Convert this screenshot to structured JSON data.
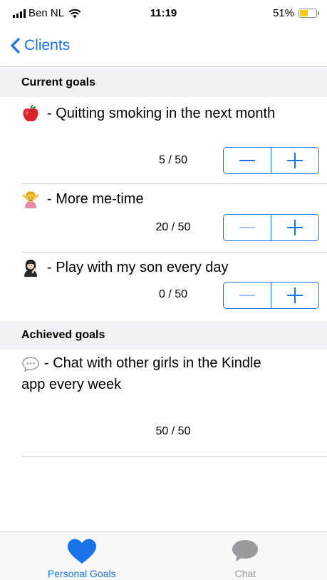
{
  "status_bar": {
    "carrier": "Ben NL",
    "time": "11:19",
    "battery_percent": "51%",
    "battery_level": 0.51,
    "battery_color": "#ffcc00"
  },
  "nav": {
    "back_label": "Clients"
  },
  "current_goals": {
    "header": "Current goals",
    "items": [
      {
        "emoji": "apple-icon",
        "title": "- Quitting smoking in the next month",
        "progress": "5 / 50"
      },
      {
        "emoji": "person-massage-icon",
        "title": "- More me-time",
        "progress": "20 / 50"
      },
      {
        "emoji": "woman-raising-hand-icon",
        "title": "- Play with my son every day",
        "progress": "0 / 50"
      }
    ]
  },
  "achieved_goals": {
    "header": "Achieved goals",
    "items": [
      {
        "emoji": "speech-bubble-icon",
        "title": "- Chat with other girls in the Kindle app every week",
        "progress": "50 / 50"
      }
    ]
  },
  "tabs": [
    {
      "label": "Personal Goals",
      "icon": "heart-icon",
      "active": true
    },
    {
      "label": "Chat",
      "icon": "chat-bubble-icon",
      "active": false
    }
  ],
  "colors": {
    "accent": "#1a73e8",
    "inactive": "#9a9a9e",
    "section_bg": "#f2f2f4"
  }
}
